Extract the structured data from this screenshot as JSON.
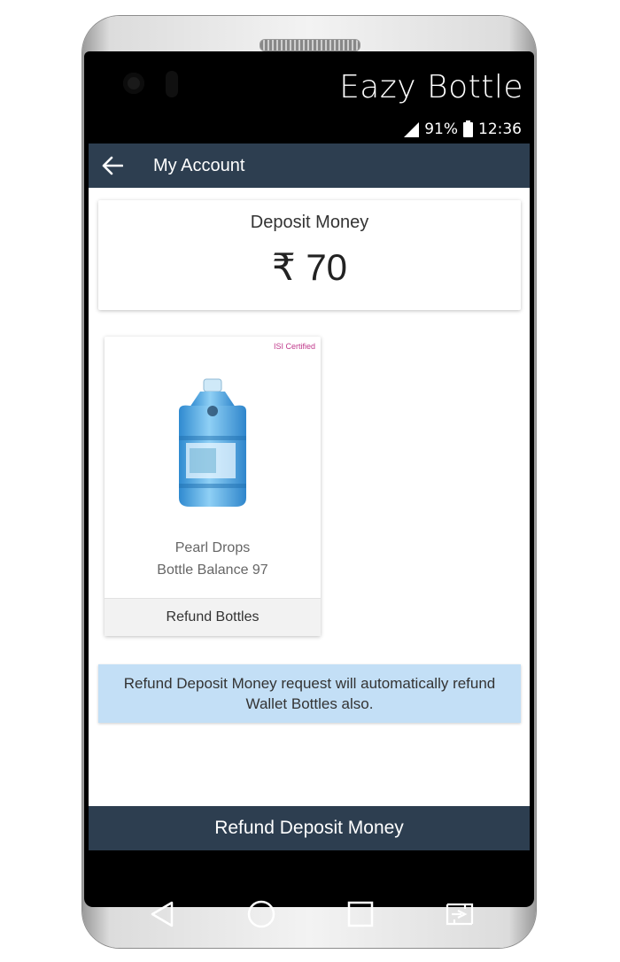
{
  "device": {
    "brand_text": "Eazy Bottle",
    "status": {
      "signal_icon": "signal-icon",
      "battery_percent": "91%",
      "battery_icon": "battery-icon",
      "time": "12:36"
    }
  },
  "appbar": {
    "back_icon": "arrow-left-icon",
    "title": "My Account"
  },
  "deposit": {
    "label": "Deposit Money",
    "amount": "₹ 70"
  },
  "product": {
    "badge": "ISI Certified",
    "image_icon": "water-bottle-icon",
    "name": "Pearl Drops",
    "balance": "Bottle Balance 97",
    "action_label": "Refund Bottles"
  },
  "notice": {
    "text": "Refund Deposit Money request will automatically refund Wallet Bottles also."
  },
  "footer": {
    "button_label": "Refund Deposit Money"
  },
  "navbar": {
    "icons": [
      "back-triangle-icon",
      "home-circle-icon",
      "recents-square-icon",
      "switch-app-icon"
    ]
  },
  "colors": {
    "appbar": "#2d3e50",
    "notice_bg": "#c3dff6",
    "badge": "#c0398b",
    "bottle": "#4aa3df"
  }
}
